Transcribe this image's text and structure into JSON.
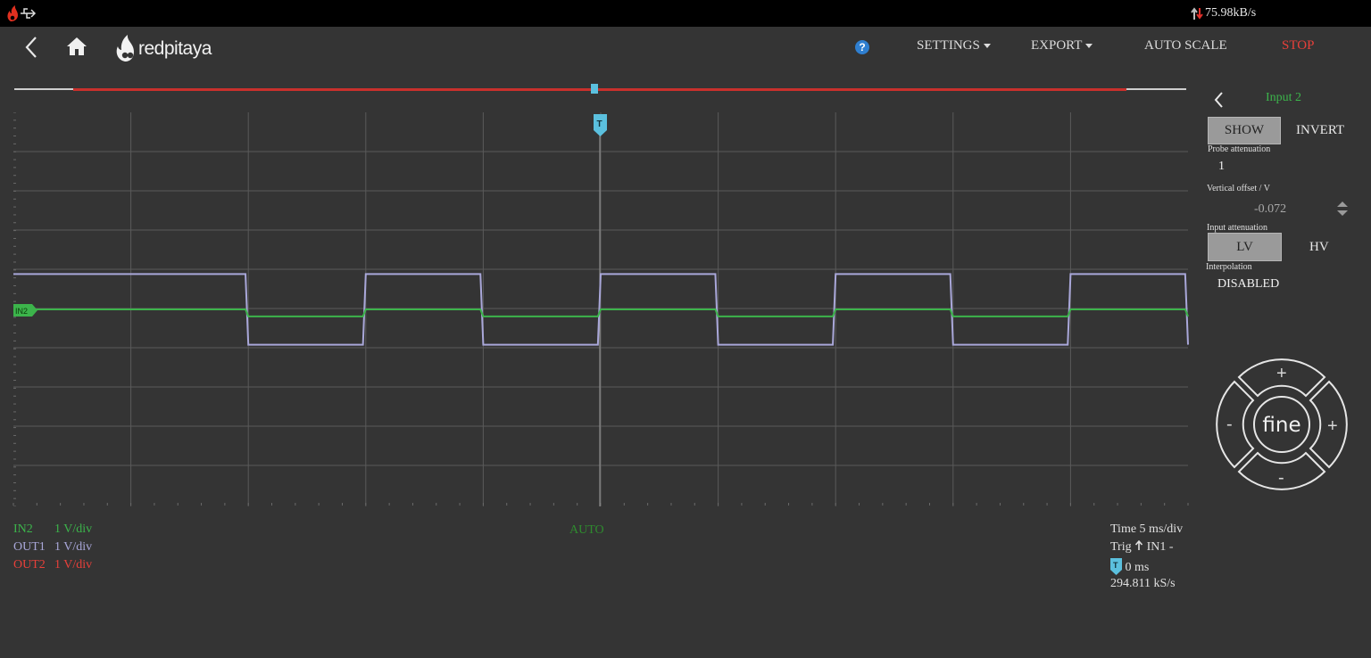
{
  "sysbar": {
    "transfer_rate": "75.98kB/s"
  },
  "header": {
    "logo": "redpitaya",
    "help": "?",
    "menu": {
      "settings": "SETTINGS",
      "export": "EXPORT",
      "auto_scale": "AUTO SCALE",
      "stop": "STOP"
    },
    "colors": {
      "stop": "#e8403a"
    }
  },
  "plot": {
    "trigger_marker": "T",
    "in2_marker": "IN2",
    "colors": {
      "in2": "#3cb44b",
      "out1": "#a9a7d9",
      "out2": "#e8403a",
      "trigger": "#5bc0de",
      "grid": "#5a5a5a"
    }
  },
  "chart_data": {
    "type": "line",
    "xlabel": "",
    "ylabel": "",
    "x_unit": "ms",
    "xlim": [
      -25,
      25
    ],
    "ylim": [
      -5,
      5
    ],
    "grid": true,
    "series": [
      {
        "name": "OUT1",
        "description": "square wave",
        "low": -0.9,
        "high": 0.9,
        "period_ms": 10,
        "first_rising_edge_ms": -20
      },
      {
        "name": "IN2",
        "description": "square wave",
        "low": -0.18,
        "high": 0.0,
        "period_ms": 10,
        "first_rising_edge_ms": -20
      }
    ]
  },
  "legend": [
    {
      "name": "IN2",
      "scale": "1 V/div",
      "color": "#3cb44b"
    },
    {
      "name": "OUT1",
      "scale": "1 V/div",
      "color": "#a9a7d9"
    },
    {
      "name": "OUT2",
      "scale": "1 V/div",
      "color": "#e8403a"
    }
  ],
  "trigger_mode": "AUTO",
  "acquisition": {
    "time": "Time 5 ms/div",
    "trig_prefix": "Trig",
    "trig_source": "IN1 -",
    "trig_delay": "0 ms",
    "sample_rate": "294.811  kS/s"
  },
  "panel": {
    "title": "Input 2",
    "show": "SHOW",
    "invert": "INVERT",
    "probe_attenuation_label": "Probe  attenuation",
    "probe_attenuation_value": "1",
    "vertical_offset_label": "Vertical  offset  / V",
    "vertical_offset_value": "-0.072",
    "input_attenuation_label": "Input attenuation",
    "lv": "LV",
    "hv": "HV",
    "interpolation_label": "Interpolation",
    "interpolation_value": "DISABLED",
    "colors": {
      "title": "#3cb44b"
    }
  },
  "dpad": {
    "center": "fine",
    "up": "+",
    "down": "-",
    "left": "-",
    "right": "+"
  }
}
